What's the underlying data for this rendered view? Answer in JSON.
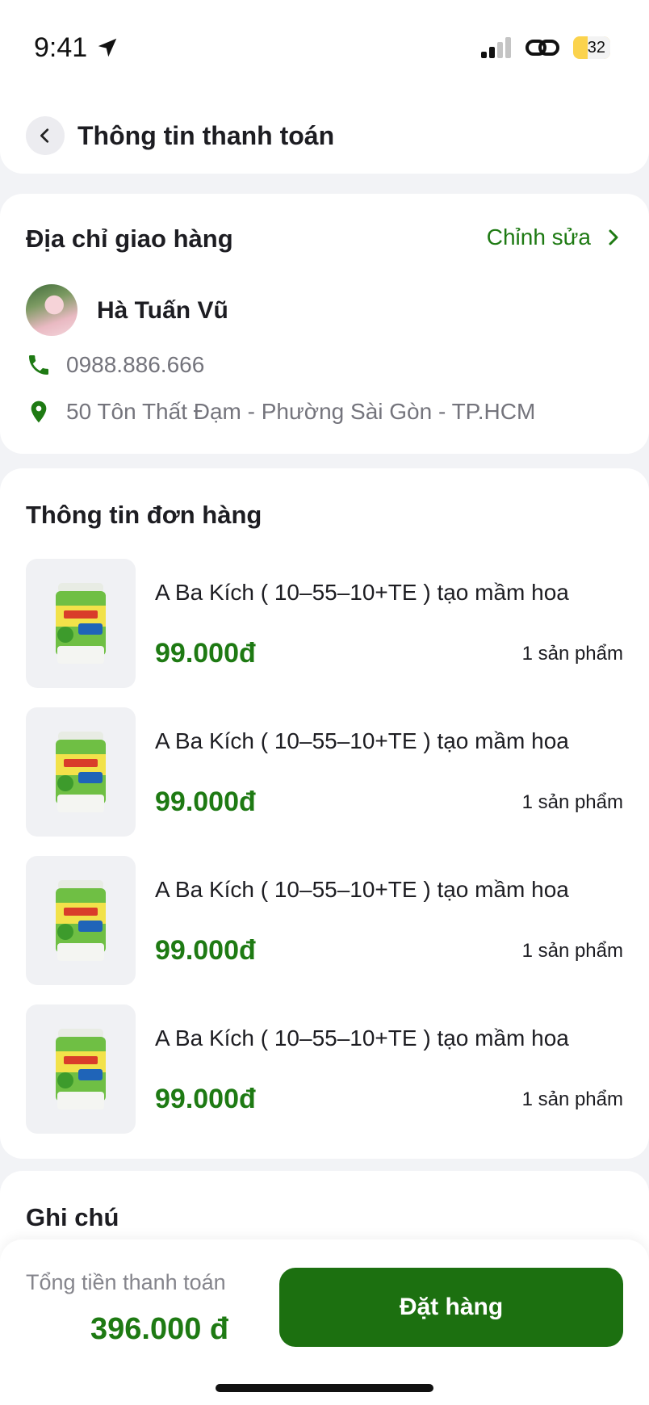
{
  "status_bar": {
    "time": "9:41",
    "battery": "32"
  },
  "header": {
    "title": "Thông tin thanh toán",
    "back_icon": "chevron-left-icon"
  },
  "address": {
    "title": "Địa chỉ giao hàng",
    "edit_label": "Chỉnh sửa",
    "name": "Hà Tuấn Vũ",
    "phone": "0988.886.666",
    "address": "50 Tôn Thất Đạm - Phường Sài Gòn - TP.HCM"
  },
  "order": {
    "title": "Thông tin đơn hàng",
    "items": [
      {
        "name": "A Ba Kích ( 10–55–10+TE ) tạo mầm hoa",
        "price": "99.000đ",
        "qty": "1 sản phẩm"
      },
      {
        "name": "A Ba Kích ( 10–55–10+TE ) tạo mầm hoa",
        "price": "99.000đ",
        "qty": "1 sản phẩm"
      },
      {
        "name": "A Ba Kích ( 10–55–10+TE ) tạo mầm hoa",
        "price": "99.000đ",
        "qty": "1 sản phẩm"
      },
      {
        "name": "A Ba Kích ( 10–55–10+TE ) tạo mầm hoa",
        "price": "99.000đ",
        "qty": "1 sản phẩm"
      }
    ]
  },
  "note": {
    "title": "Ghi chú"
  },
  "footer": {
    "total_label": "Tổng tiền thanh toán",
    "total_value": "396.000 đ",
    "order_button": "Đặt hàng"
  },
  "colors": {
    "accent": "#1e7a13",
    "button": "#1c7010",
    "background": "#f2f3f6"
  }
}
